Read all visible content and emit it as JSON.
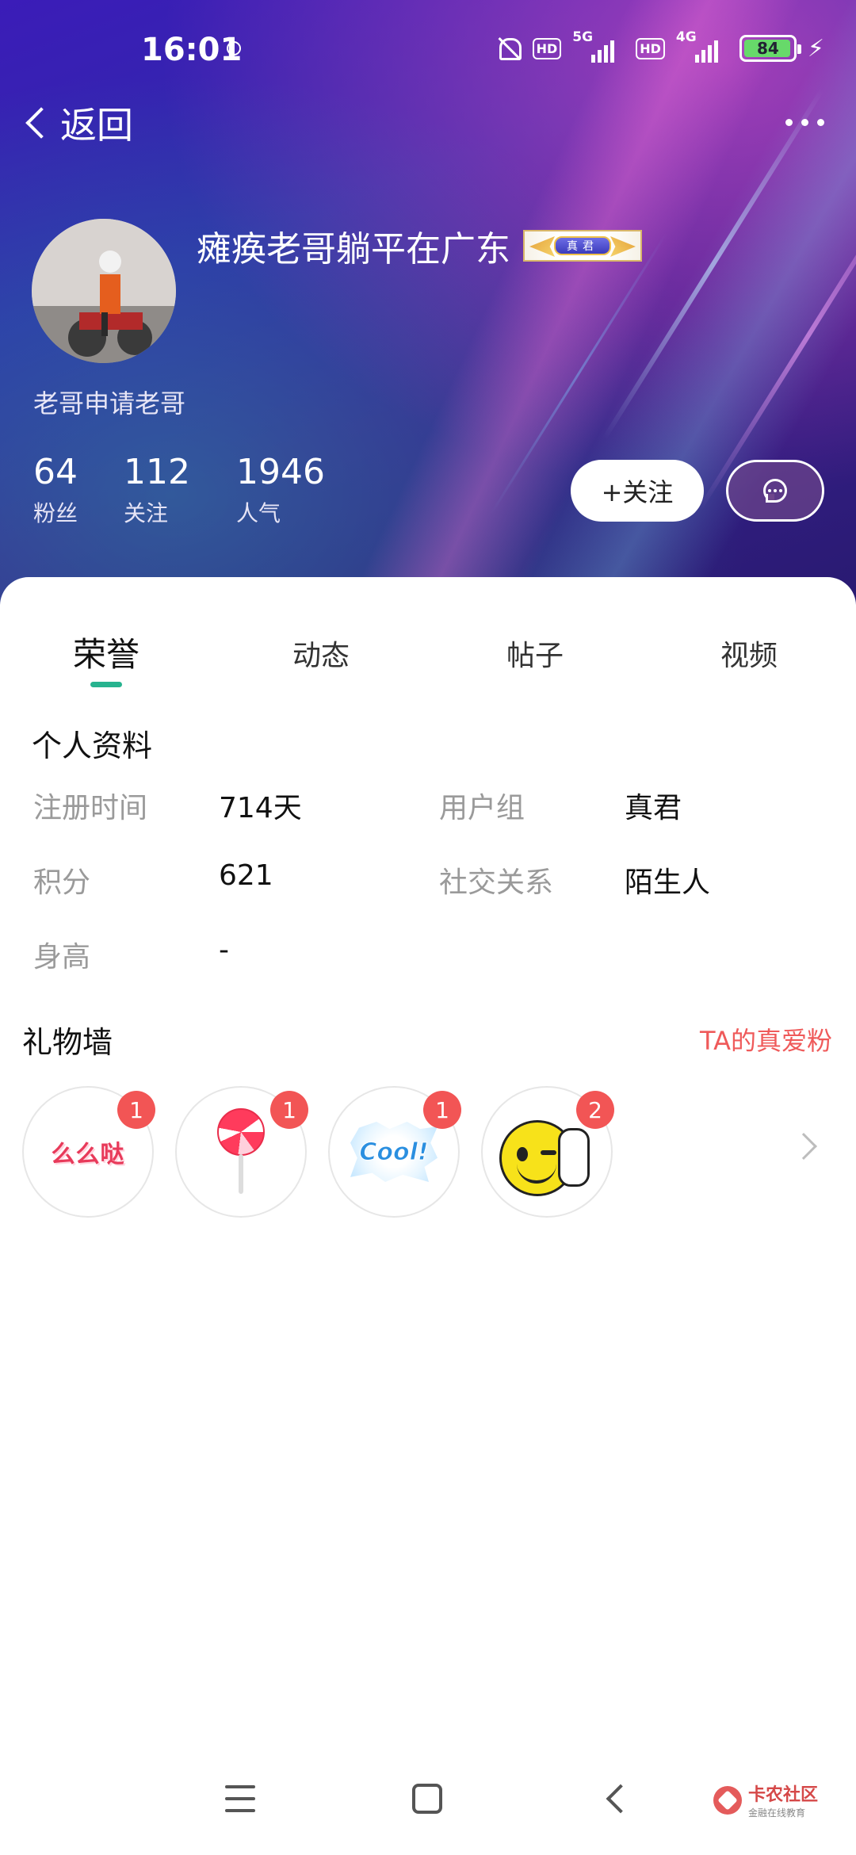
{
  "status_bar": {
    "time": "16:01",
    "battery": "84",
    "hd": "HD",
    "net1": "5G",
    "net2": "4G"
  },
  "nav": {
    "back_label": "返回"
  },
  "profile": {
    "username": "瘫痪老哥躺平在广东",
    "badge": "真君",
    "signature": "老哥申请老哥",
    "stats": [
      {
        "value": "64",
        "label": "粉丝"
      },
      {
        "value": "112",
        "label": "关注"
      },
      {
        "value": "1946",
        "label": "人气"
      }
    ],
    "follow_label": "+关注"
  },
  "tabs": [
    {
      "label": "荣誉",
      "active": true
    },
    {
      "label": "动态",
      "active": false
    },
    {
      "label": "帖子",
      "active": false
    },
    {
      "label": "视频",
      "active": false
    }
  ],
  "info": {
    "title": "个人资料",
    "rows": [
      {
        "label": "注册时间",
        "value": "714天",
        "label2": "用户组",
        "value2": "真君"
      },
      {
        "label": "积分",
        "value": "621",
        "label2": "社交关系",
        "value2": "陌生人"
      },
      {
        "label": "身高",
        "value": "-"
      }
    ]
  },
  "gifts": {
    "title": "礼物墙",
    "link": "TA的真爱粉",
    "items": [
      {
        "name": "么么哒",
        "count": "1",
        "art_text": "么么哒"
      },
      {
        "name": "lollipop",
        "count": "1"
      },
      {
        "name": "cool",
        "count": "1",
        "art_text": "Cool!"
      },
      {
        "name": "thumbs-up-smiley",
        "count": "2"
      }
    ]
  },
  "watermark": {
    "title": "卡农社区",
    "subtitle": "金融在线教育"
  },
  "colors": {
    "accent": "#27b38f",
    "badge_red": "#f25555",
    "link_red": "#ef5a5a"
  }
}
